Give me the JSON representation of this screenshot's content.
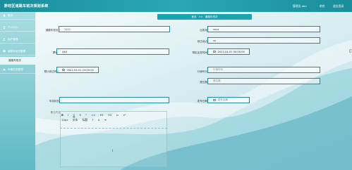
{
  "header": {
    "title": "黔旺区道路车班次规划系统",
    "admin_label": "管理员 abo",
    "home_link": "前台",
    "logout_link": "退出登录"
  },
  "sidebar": {
    "items": [
      {
        "label": "首页",
        "icon": "home-icon"
      },
      {
        "label": "个人中心",
        "icon": "user-icon"
      },
      {
        "label": "用户管理",
        "icon": "users-icon"
      },
      {
        "label": "道路车班次管理",
        "icon": "bus-icon"
      },
      {
        "label": "道路车班次",
        "sub": true
      },
      {
        "label": "车辆信息管理",
        "icon": "car-icon"
      }
    ]
  },
  "breadcrumb": {
    "root": "首页",
    "separator": ">>",
    "current": "道路车班次"
  },
  "form": {
    "route_code_label": "道路车班次号",
    "route_code_value": "1111",
    "origin_label": "出发地",
    "origin_value": "xxxx",
    "destination_label": "到达地点",
    "destination_value": "xx",
    "price_label": "票价",
    "price_value": "XXX",
    "depart_time_label": "预定出发时间",
    "depart_time_value": "2022-04-01 00:00:00",
    "arrive_time_label": "预计到达时间",
    "arrive_time_value": "2022-04-01 23:00:00",
    "duration_label": "行驶时长",
    "duration_placeholder": "行驶时长",
    "seats_label": "座位数",
    "seats_placeholder": "座位数",
    "status_label": "车站状态",
    "status_placeholder": "",
    "driver_label": "发车日期",
    "driver_placeholder": "发车日期",
    "notes_label": "备注内容"
  },
  "editor": {
    "toolbar": [
      "B",
      "I",
      "U",
      "S",
      "\"",
      "<>",
      "H1",
      "H2",
      "x₂",
      "x²",
      "≡",
      "≡",
      "T",
      "A",
      "A̲",
      "≡",
      "⌐"
    ],
    "row2": [
      "14px",
      "文本",
      "标题"
    ]
  }
}
